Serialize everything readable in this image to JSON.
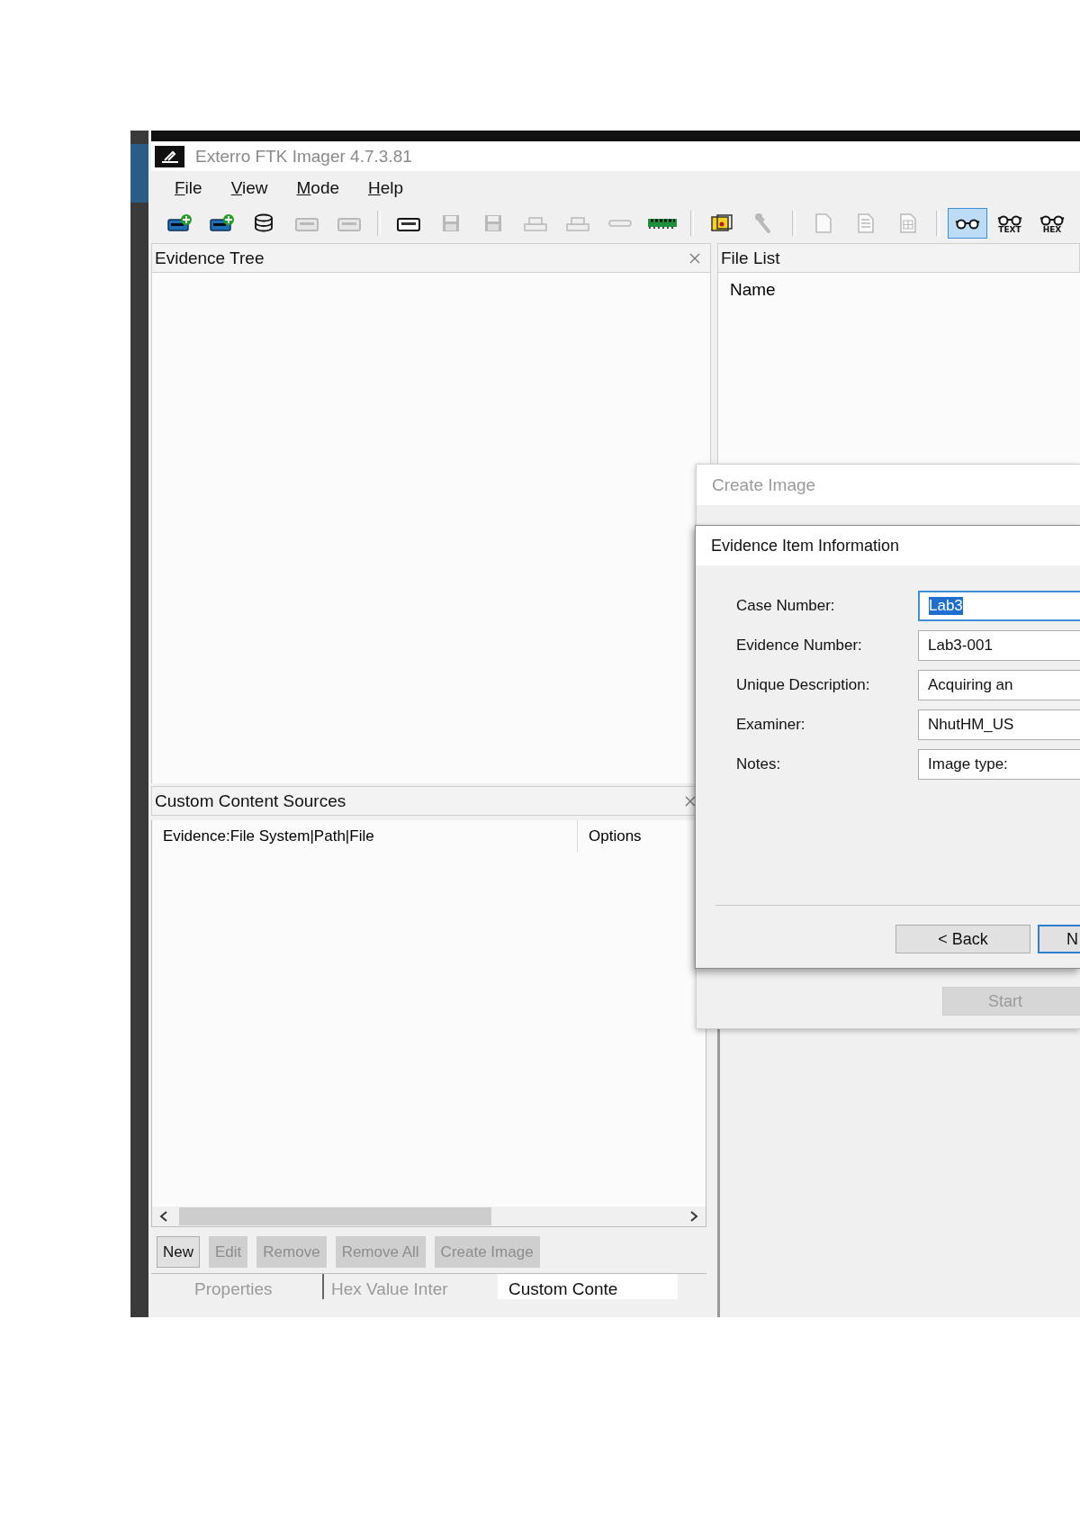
{
  "window": {
    "title": "Exterro FTK Imager 4.7.3.81",
    "active": false
  },
  "menu": [
    {
      "label": "File",
      "access_key_underlined": true
    },
    {
      "label": "View",
      "access_key_underlined": true
    },
    {
      "label": "Mode",
      "access_key_underlined": true
    },
    {
      "label": "Help",
      "access_key_underlined": true
    }
  ],
  "toolbar": [
    {
      "kind": "drive-plus",
      "disabled": false,
      "selected": false
    },
    {
      "kind": "drive-plus",
      "disabled": false,
      "selected": false
    },
    {
      "kind": "disk-stack",
      "disabled": false,
      "selected": false
    },
    {
      "kind": "drive",
      "disabled": true,
      "selected": false
    },
    {
      "kind": "drive",
      "disabled": true,
      "selected": false
    },
    {
      "kind": "separator"
    },
    {
      "kind": "drive",
      "disabled": false,
      "selected": false
    },
    {
      "kind": "floppy",
      "disabled": true,
      "selected": false
    },
    {
      "kind": "floppy",
      "disabled": true,
      "selected": false
    },
    {
      "kind": "box-stack",
      "disabled": true,
      "selected": false
    },
    {
      "kind": "box-stack",
      "disabled": true,
      "selected": false
    },
    {
      "kind": "slot",
      "disabled": true,
      "selected": false
    },
    {
      "kind": "memory-chip",
      "disabled": false,
      "selected": false
    },
    {
      "kind": "separator"
    },
    {
      "kind": "yellow-box",
      "disabled": false,
      "selected": false
    },
    {
      "kind": "wrench",
      "disabled": true,
      "selected": false
    },
    {
      "kind": "separator"
    },
    {
      "kind": "page",
      "disabled": true,
      "selected": false
    },
    {
      "kind": "page-lines",
      "disabled": true,
      "selected": false
    },
    {
      "kind": "page-grid",
      "disabled": true,
      "selected": false
    },
    {
      "kind": "separator"
    },
    {
      "kind": "glasses",
      "disabled": false,
      "selected": true
    },
    {
      "kind": "glasses",
      "disabled": false,
      "selected": false,
      "label": "TEXT"
    },
    {
      "kind": "glasses",
      "disabled": false,
      "selected": false,
      "label": "HEX"
    }
  ],
  "evidence_tree": {
    "title": "Evidence Tree"
  },
  "custom_content_sources": {
    "title": "Custom Content Sources",
    "columns": [
      "Evidence:File System|Path|File",
      "Options"
    ],
    "buttons": [
      {
        "label": "New",
        "disabled": false
      },
      {
        "label": "Edit",
        "disabled": true
      },
      {
        "label": "Remove",
        "disabled": true
      },
      {
        "label": "Remove All",
        "disabled": true
      },
      {
        "label": "Create Image",
        "disabled": true
      }
    ]
  },
  "bottom_tabs": [
    {
      "label": "Properties",
      "selected": false
    },
    {
      "label": "Hex Value Inter",
      "selected": false
    },
    {
      "label": "Custom Conte",
      "selected": true
    }
  ],
  "file_list": {
    "title": "File List",
    "columns": [
      "Name"
    ]
  },
  "create_image_dialog": {
    "title": "Create Image",
    "buttons": [
      {
        "label": "Start",
        "disabled": true
      }
    ]
  },
  "evidence_item_dialog": {
    "title": "Evidence Item Information",
    "fields": [
      {
        "label": "Case Number:",
        "value": "Lab3",
        "focused": true
      },
      {
        "label": "Evidence Number:",
        "value": "Lab3-001",
        "focused": false
      },
      {
        "label": "Unique Description:",
        "value": "Acquiring an",
        "focused": false
      },
      {
        "label": "Examiner:",
        "value": "NhutHM_US",
        "focused": false
      },
      {
        "label": "Notes:",
        "value": "Image type:",
        "focused": false
      }
    ],
    "buttons": [
      {
        "label": "< Back",
        "default": false
      },
      {
        "label": "N",
        "default": true
      }
    ]
  }
}
